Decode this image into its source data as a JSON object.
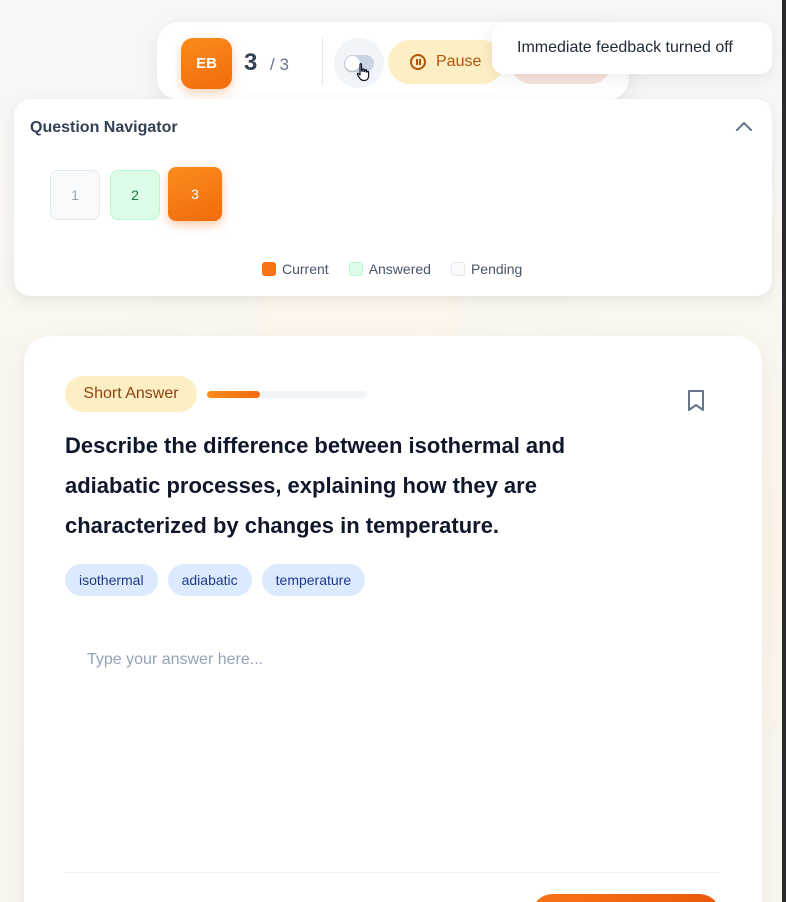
{
  "toolbar": {
    "avatar_initials": "EB",
    "current_question": "3",
    "total_questions": "/ 3",
    "pause_label": "Pause",
    "feedback_toggle_on": false
  },
  "toast": {
    "message": "Immediate feedback turned off"
  },
  "navigator": {
    "title": "Question Navigator",
    "questions": [
      {
        "label": "1",
        "state": "pending"
      },
      {
        "label": "2",
        "state": "answered"
      },
      {
        "label": "3",
        "state": "current"
      }
    ],
    "legend": {
      "current": "Current",
      "answered": "Answered",
      "pending": "Pending"
    }
  },
  "question": {
    "type_label": "Short Answer",
    "progress_fraction": 0.33,
    "text": "Describe the difference between isothermal and adiabatic processes, explaining how they are characterized by changes in temperature.",
    "tags": [
      "isothermal",
      "adiabatic",
      "temperature"
    ],
    "answer_value": "",
    "answer_placeholder": "Type your answer here..."
  },
  "colors": {
    "accent": "#f97316",
    "answered": "#dcfce7",
    "pending": "#f8fafc",
    "badge": "#fdeec4",
    "tag": "#dbeafe"
  }
}
